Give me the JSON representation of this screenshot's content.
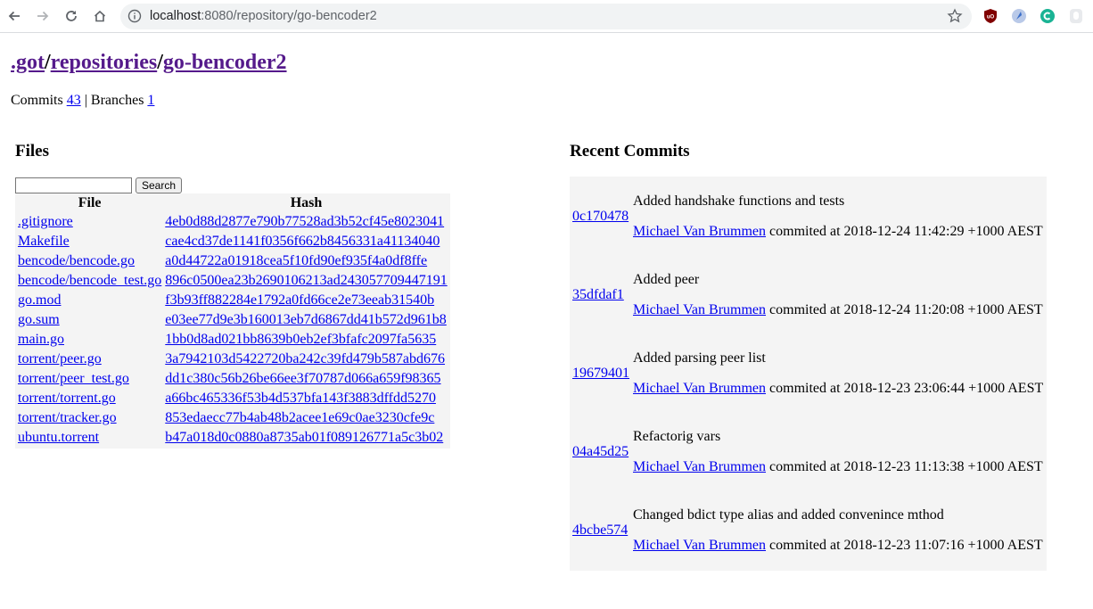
{
  "browser": {
    "url_host": "localhost",
    "url_path": ":8080/repository/go-bencoder2"
  },
  "breadcrumb": {
    "root": ".got",
    "sep1": "/",
    "repositories": "repositories",
    "sep2": "/",
    "repo": "go-bencoder2"
  },
  "counts": {
    "commits_label": "Commits",
    "commits_value": "43",
    "separator": "|",
    "branches_label": "Branches",
    "branches_value": "1"
  },
  "files": {
    "heading": "Files",
    "search_placeholder": "",
    "search_button": "Search",
    "columns": [
      "File",
      "Hash"
    ],
    "rows": [
      {
        "file": ".gitignore",
        "hash": "4eb0d88d2877e790b77528ad3b52cf45e8023041"
      },
      {
        "file": "Makefile",
        "hash": "cae4cd37de1141f0356f662b8456331a41134040"
      },
      {
        "file": "bencode/bencode.go",
        "hash": "a0d44722a01918cea5f10fd90ef935f4a0df8ffe"
      },
      {
        "file": "bencode/bencode_test.go",
        "hash": "896c0500ea23b2690106213ad243057709447191"
      },
      {
        "file": "go.mod",
        "hash": "f3b93ff882284e1792a0fd66ce2e73eeab31540b"
      },
      {
        "file": "go.sum",
        "hash": "e03ee77d9e3b160013eb7d6867dd41b572d961b8"
      },
      {
        "file": "main.go",
        "hash": "1bb0d8ad021bb8639b0eb2ef3bfafc2097fa5635"
      },
      {
        "file": "torrent/peer.go",
        "hash": "3a7942103d5422720ba242c39fd479b587abd676"
      },
      {
        "file": "torrent/peer_test.go",
        "hash": "dd1c380c56b26be66ee3f70787d066a659f98365"
      },
      {
        "file": "torrent/torrent.go",
        "hash": "a66bc465336f53b4d537bfa143f3883dffdd5270"
      },
      {
        "file": "torrent/tracker.go",
        "hash": "853edaecc77b4ab48b2acee1e69c0ae3230cfe9c"
      },
      {
        "file": "ubuntu.torrent",
        "hash": "b47a018d0c0880a8735ab01f089126771a5c3b02"
      }
    ]
  },
  "commits": {
    "heading": "Recent Commits",
    "items": [
      {
        "hash": "0c170478",
        "message": "Added handshake functions and tests",
        "author": "Michael Van Brummen",
        "meta": " commited at 2018-12-24 11:42:29 +1000 AEST"
      },
      {
        "hash": "35dfdaf1",
        "message": "Added peer",
        "author": "Michael Van Brummen",
        "meta": " commited at 2018-12-24 11:20:08 +1000 AEST"
      },
      {
        "hash": "19679401",
        "message": "Added parsing peer list",
        "author": "Michael Van Brummen",
        "meta": " commited at 2018-12-23 23:06:44 +1000 AEST"
      },
      {
        "hash": "04a45d25",
        "message": "Refactorig vars",
        "author": "Michael Van Brummen",
        "meta": " commited at 2018-12-23 11:13:38 +1000 AEST"
      },
      {
        "hash": "4bcbe574",
        "message": "Changed bdict type alias and added convenince mthod",
        "author": "Michael Van Brummen",
        "meta": " commited at 2018-12-23 11:07:16 +1000 AEST"
      }
    ]
  },
  "icons": {
    "back": "arrow-left-icon",
    "forward": "arrow-right-icon",
    "reload": "reload-icon",
    "home": "home-icon",
    "info": "info-icon",
    "star": "star-icon",
    "ext1": "ublock-icon",
    "ext2": "extension-blue-icon",
    "ext3": "extension-green-icon"
  },
  "colors": {
    "link": "#0000ee",
    "visited_link": "#551a8b",
    "panel_bg": "#f4f4f4"
  }
}
